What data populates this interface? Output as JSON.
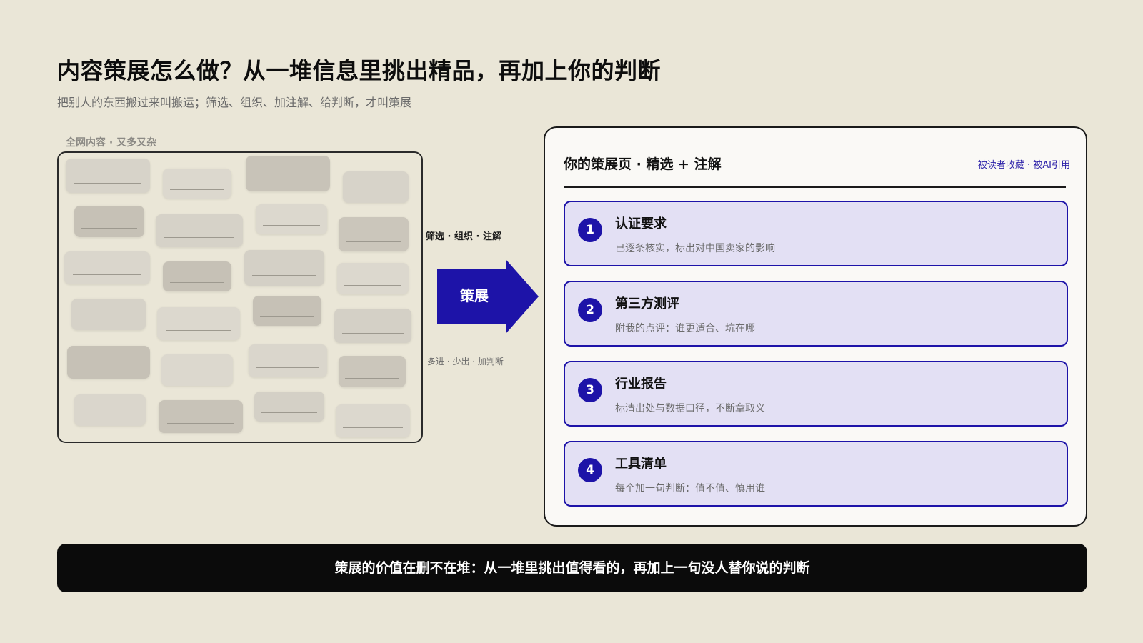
{
  "header": {
    "title": "内容策展怎么做？从一堆信息里挑出精品，再加上你的判断",
    "subtitle": "把别人的东西搬过来叫搬运；筛选、组织、加注解、给判断，才叫策展"
  },
  "left": {
    "label": "全网内容 · 又多又杂"
  },
  "middle": {
    "top_label": "筛选 · 组织 · 注解",
    "arrow_label": "策展",
    "bottom_label": "多进 · 少出 · 加判断"
  },
  "panel": {
    "title": "你的策展页 · 精选 + 注解",
    "badge": "被读者收藏 · 被AI引用",
    "items": [
      {
        "num": "1",
        "title": "认证要求",
        "desc": "已逐条核实，标出对中国卖家的影响"
      },
      {
        "num": "2",
        "title": "第三方测评",
        "desc": "附我的点评：谁更适合、坑在哪"
      },
      {
        "num": "3",
        "title": "行业报告",
        "desc": "标清出处与数据口径，不断章取义"
      },
      {
        "num": "4",
        "title": "工具清单",
        "desc": "每个加一句判断：值不值、慎用谁"
      }
    ]
  },
  "footer": {
    "banner": "策展的价值在删不在堆：从一堆里挑出值得看的，再加上一句没人替你说的判断"
  },
  "colors": {
    "background": "#eae6d7",
    "accent": "#1d13a8",
    "card_fill": "#e3e0f4",
    "banner": "#0b0b0b"
  }
}
